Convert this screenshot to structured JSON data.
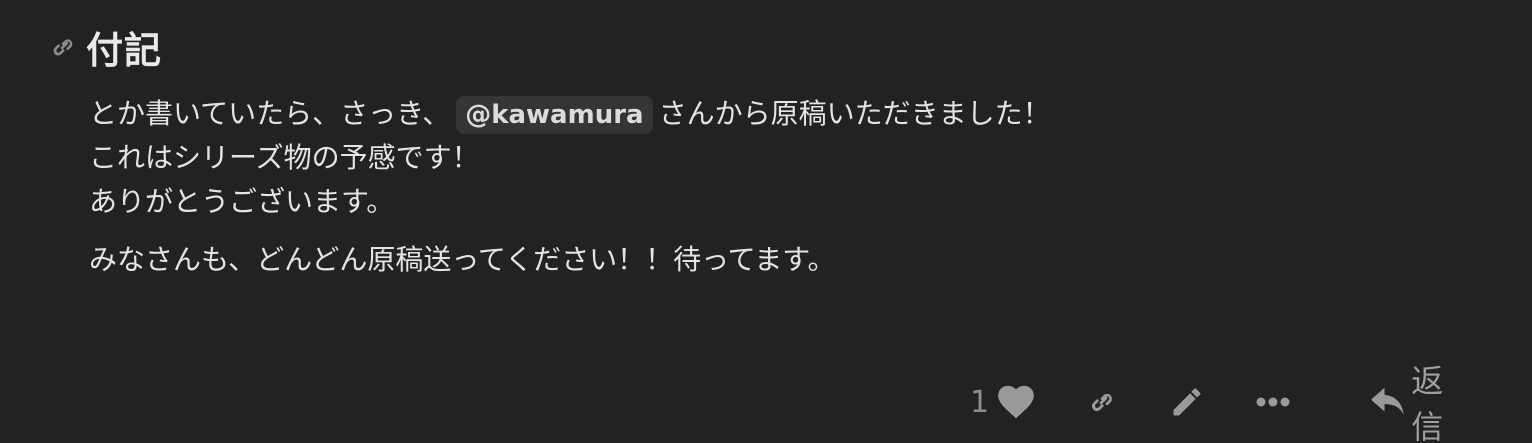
{
  "post": {
    "heading": "付記",
    "paragraphs": {
      "line1_before": "とか書いていたら、さっき、",
      "mention": "@kawamura",
      "line1_after": "さんから原稿いただきました！",
      "line2": "これはシリーズ物の予感です！",
      "line3": "ありがとうございます。",
      "line4": "みなさんも、どんどん原稿送ってください！！待ってます。"
    }
  },
  "actions": {
    "like_count": "1",
    "reply_label": "返信"
  },
  "icons": {
    "anchor": "link-icon",
    "like": "heart-icon",
    "share": "link-icon",
    "edit": "pencil-icon",
    "more": "ellipsis-icon",
    "reply": "reply-arrow-icon"
  },
  "colors": {
    "background": "#222222",
    "text": "#e4e4e4",
    "muted": "#9a9a9a",
    "mention_bg": "#353535"
  }
}
